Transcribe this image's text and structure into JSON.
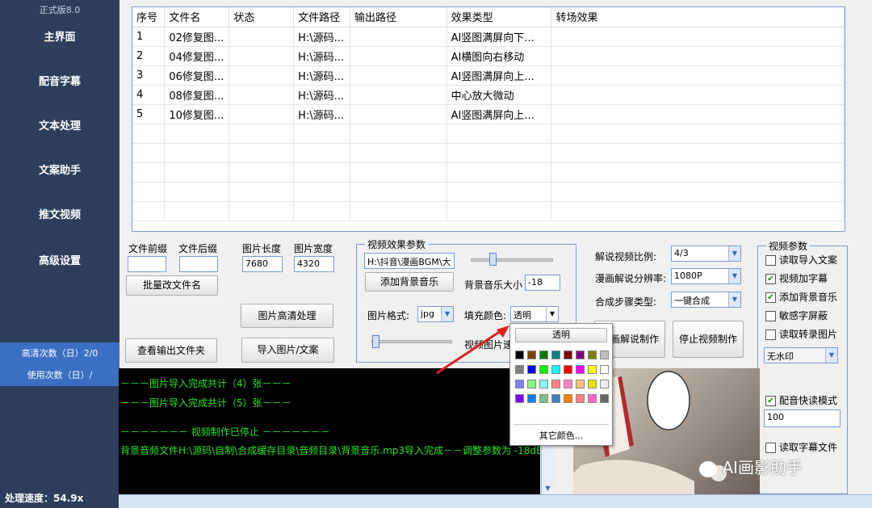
{
  "sidebar": {
    "version": "正式版8.0",
    "items": [
      "主界面",
      "配音字幕",
      "文本处理",
      "文案助手",
      "推文视频",
      "高级设置"
    ],
    "hd_count": "高清次数（日）2/0",
    "use_count": "使用次数（日）/",
    "speed": "处理速度：54.9x"
  },
  "table": {
    "headers": [
      "序号",
      "文件名",
      "状态",
      "文件路径",
      "输出路径",
      "效果类型",
      "转场效果"
    ],
    "rows": [
      [
        "1",
        "02修复图...",
        "",
        "H:\\源码...",
        "",
        "AI竖图满屏向下...",
        ""
      ],
      [
        "2",
        "04修复图...",
        "",
        "H:\\源码...",
        "",
        "AI横图向右移动",
        ""
      ],
      [
        "3",
        "06修复图...",
        "",
        "H:\\源码...",
        "",
        "AI竖图满屏向上...",
        ""
      ],
      [
        "4",
        "08修复图...",
        "",
        "H:\\源码...",
        "",
        "中心放大微动",
        ""
      ],
      [
        "5",
        "10修复图...",
        "",
        "H:\\源码...",
        "",
        "AI竖图满屏向上...",
        ""
      ]
    ]
  },
  "files": {
    "prefix_label": "文件前缀",
    "suffix_label": "文件后缀",
    "width_label": "图片长度",
    "height_label": "图片宽度",
    "width_value": "7680",
    "height_value": "4320",
    "batch_rename": "批量改文件名",
    "enhance": "图片高清处理",
    "view_output": "查看输出文件夹",
    "import": "导入图片/文案"
  },
  "video_params": {
    "legend": "视频效果参数",
    "music_path": "H:\\抖音\\漫画BGM\\大",
    "add_music": "添加背景音乐",
    "music_volume_label": "背景音乐大小",
    "music_volume": "-18",
    "format_label": "图片格式:",
    "format_value": "jpg",
    "fill_label": "填充颜色:",
    "fill_value": "透明",
    "speed_label": "视频图片速"
  },
  "picker": {
    "transparent": "透明",
    "other": "其它颜色...",
    "colors": [
      "#000000",
      "#804000",
      "#008000",
      "#008080",
      "#800000",
      "#800080",
      "#808000",
      "#c0c0c0",
      "#808080",
      "#0000ff",
      "#00ff00",
      "#00ffff",
      "#ff0000",
      "#ff00ff",
      "#ffff00",
      "#ffffff",
      "#8080ff",
      "#80ff80",
      "#80ffff",
      "#ff8080",
      "#ff80c0",
      "#ffc080",
      "#e6e600",
      "#f0f0f0",
      "#8000ff",
      "#0080ff",
      "#80c080",
      "#4080c0",
      "#ff8000",
      "#ff8080",
      "#ff66cc",
      "#666666"
    ]
  },
  "explain": {
    "ratio_label": "解说视频比例:",
    "ratio_value": "4/3",
    "res_label": "漫画解说分辨率:",
    "res_value": "1080P",
    "steps_label": "合成步骤类型:",
    "steps_value": "一键合成",
    "make": "漫画解说制作",
    "stop": "停止视频制作"
  },
  "video_opts": {
    "legend": "视频参数",
    "read_doc": "读取导入文案",
    "subtitle": "视频加字幕",
    "bgm": "添加背景音乐",
    "sensitive": "敏感字屏蔽",
    "read_img": "读取转录图片",
    "watermark": "无水印",
    "fast_read": "配音快读模式",
    "fast_value": "100",
    "read_sub": "读取字幕文件",
    "checked": {
      "read_doc": false,
      "subtitle": true,
      "bgm": true,
      "sensitive": false,
      "read_img": false,
      "fast_read": true,
      "read_sub": false
    }
  },
  "console": [
    "－－－图片导入完成共计（4）张－－－",
    "－－－图片导入完成共计（5）张－－－",
    "－－－－－－－ 视频制作已停止 －－－－－－－",
    "背景音频文件H:\\源码\\自制\\合成缓存目录\\音频目录\\背景音乐.mp3导入完成－－调整参数为 -18dB"
  ],
  "watermark_text": "AI画影助手",
  "colors": {
    "sidebar": "#2c3e5c",
    "accent": "#3a6fc4",
    "console_text": "#24e624"
  }
}
